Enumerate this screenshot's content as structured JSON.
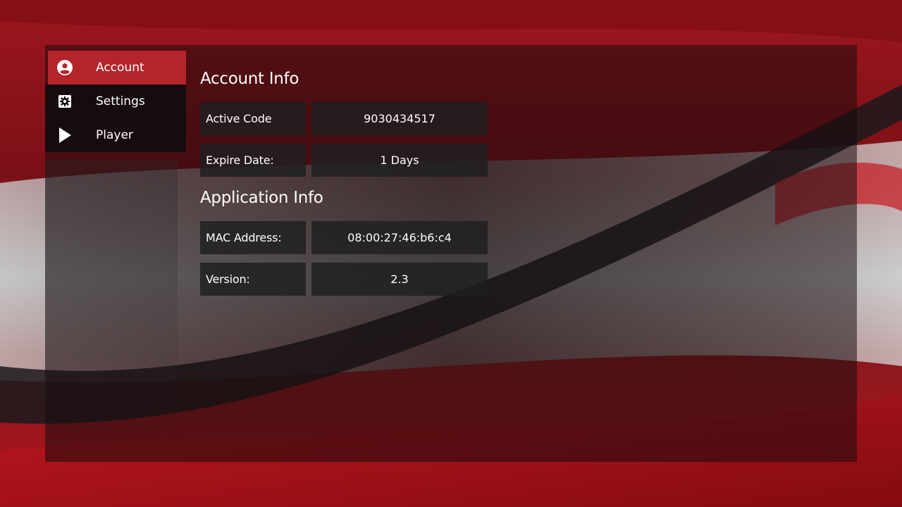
{
  "sidebar": {
    "items": [
      {
        "label": "Account",
        "icon": "account-circle-icon",
        "active": true
      },
      {
        "label": "Settings",
        "icon": "gear-icon",
        "active": false
      },
      {
        "label": "Player",
        "icon": "play-icon",
        "active": false
      }
    ]
  },
  "account_info": {
    "title": "Account Info",
    "rows": [
      {
        "label": "Active Code",
        "value": "9030434517"
      },
      {
        "label": "Expire Date:",
        "value": "1 Days"
      }
    ]
  },
  "application_info": {
    "title": "Application Info",
    "rows": [
      {
        "label": "MAC Address:",
        "value": "08:00:27:46:b6:c4"
      },
      {
        "label": "Version:",
        "value": "2.3"
      }
    ]
  },
  "colors": {
    "accent": "#b3252b",
    "background": "#8e0f16",
    "panel": "#160a0c",
    "text": "#ffffff"
  }
}
